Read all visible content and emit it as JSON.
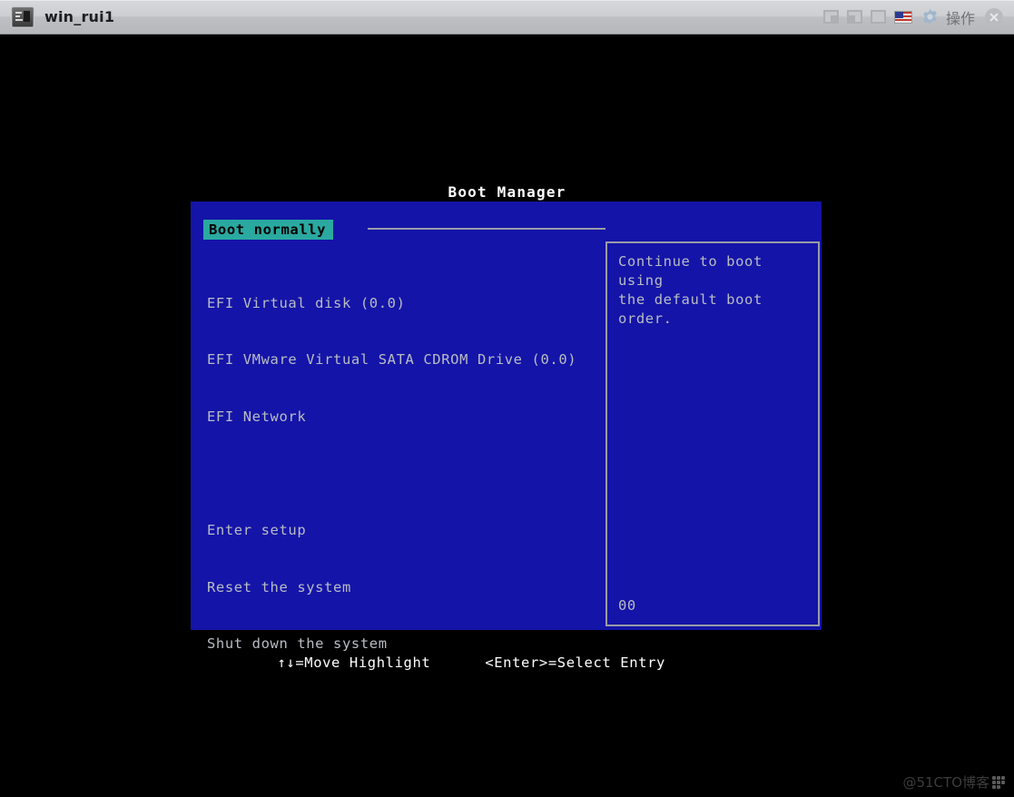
{
  "window": {
    "title": "win_rui1",
    "app_icon": "terminal-icon",
    "controls": [
      {
        "name": "restore-window-button",
        "icon": "restore-down-icon"
      },
      {
        "name": "minimize-window-button",
        "icon": "minimize-icon"
      },
      {
        "name": "maximize-window-button",
        "icon": "maximize-icon"
      },
      {
        "name": "keyboard-language-button",
        "icon": "us-flag-icon"
      }
    ],
    "action_menu": {
      "icon": "gear-icon",
      "label": "操作"
    },
    "close": {
      "icon": "close-icon",
      "label": "×"
    }
  },
  "bios": {
    "title": "Boot Manager",
    "highlighted_item": "Boot normally",
    "menu_items": [
      {
        "label": "EFI Virtual disk (0.0)",
        "group": 1
      },
      {
        "label": "EFI VMware Virtual SATA CDROM Drive (0.0)",
        "group": 1
      },
      {
        "label": "EFI Network",
        "group": 1
      },
      {
        "label": "Enter setup",
        "group": 2
      },
      {
        "label": "Reset the system",
        "group": 2
      },
      {
        "label": "Shut down the system",
        "group": 2
      }
    ],
    "help": {
      "text": "Continue to boot using\nthe default boot order.",
      "code": "00"
    },
    "footer": {
      "move_hint": "↑↓=Move Highlight",
      "select_hint": "<Enter>=Select Entry"
    }
  },
  "watermark": {
    "text": "@51CTO博客"
  },
  "colors": {
    "panel_blue": "#1414a8",
    "highlight_teal": "#2aa9a0",
    "text_gray": "#b9bcc4",
    "border_gray": "#9a9ca6",
    "titlebar": "#cdcfd2"
  }
}
